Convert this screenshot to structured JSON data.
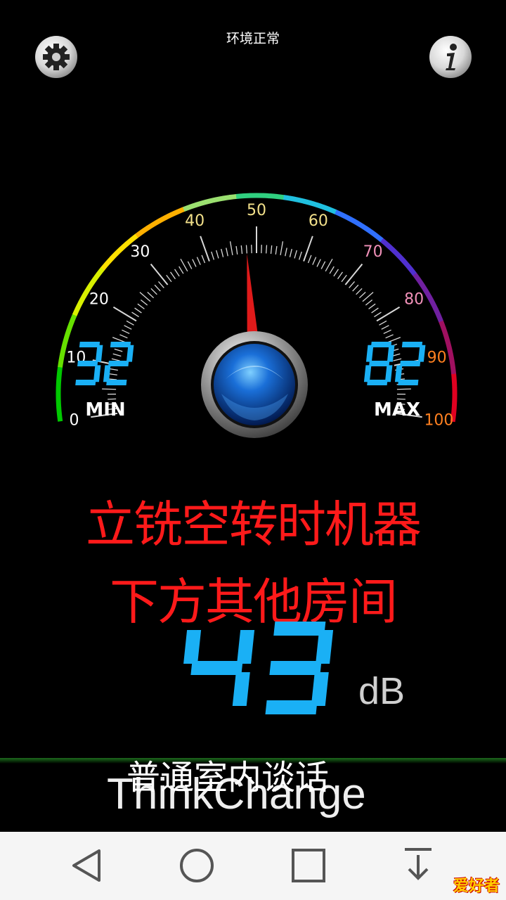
{
  "status": {
    "text": "环境正常"
  },
  "icons": {
    "settings": "gear-icon",
    "info": "info-icon"
  },
  "gauge": {
    "ticks": [
      "0",
      "10",
      "20",
      "30",
      "40",
      "50",
      "60",
      "70",
      "80",
      "90",
      "100"
    ],
    "min_label": "MIN",
    "max_label": "MAX",
    "min_value": "32",
    "max_value": "82",
    "needle_value": 48
  },
  "title": {
    "line1": "立铣空转时机器",
    "line2": "下方其他房间"
  },
  "reading": {
    "value": "43",
    "unit": "dB"
  },
  "level_text": "普通室内谈话",
  "brand": "ThinkChange",
  "nav": {
    "back": "back-icon",
    "home": "home-icon",
    "recents": "recents-icon",
    "down": "download-icon"
  },
  "watermark": "爱好者",
  "colors": {
    "digits": "#1ab0f5",
    "title": "#ff1a1a",
    "background": "#000000",
    "navbar": "#f5f5f5"
  }
}
